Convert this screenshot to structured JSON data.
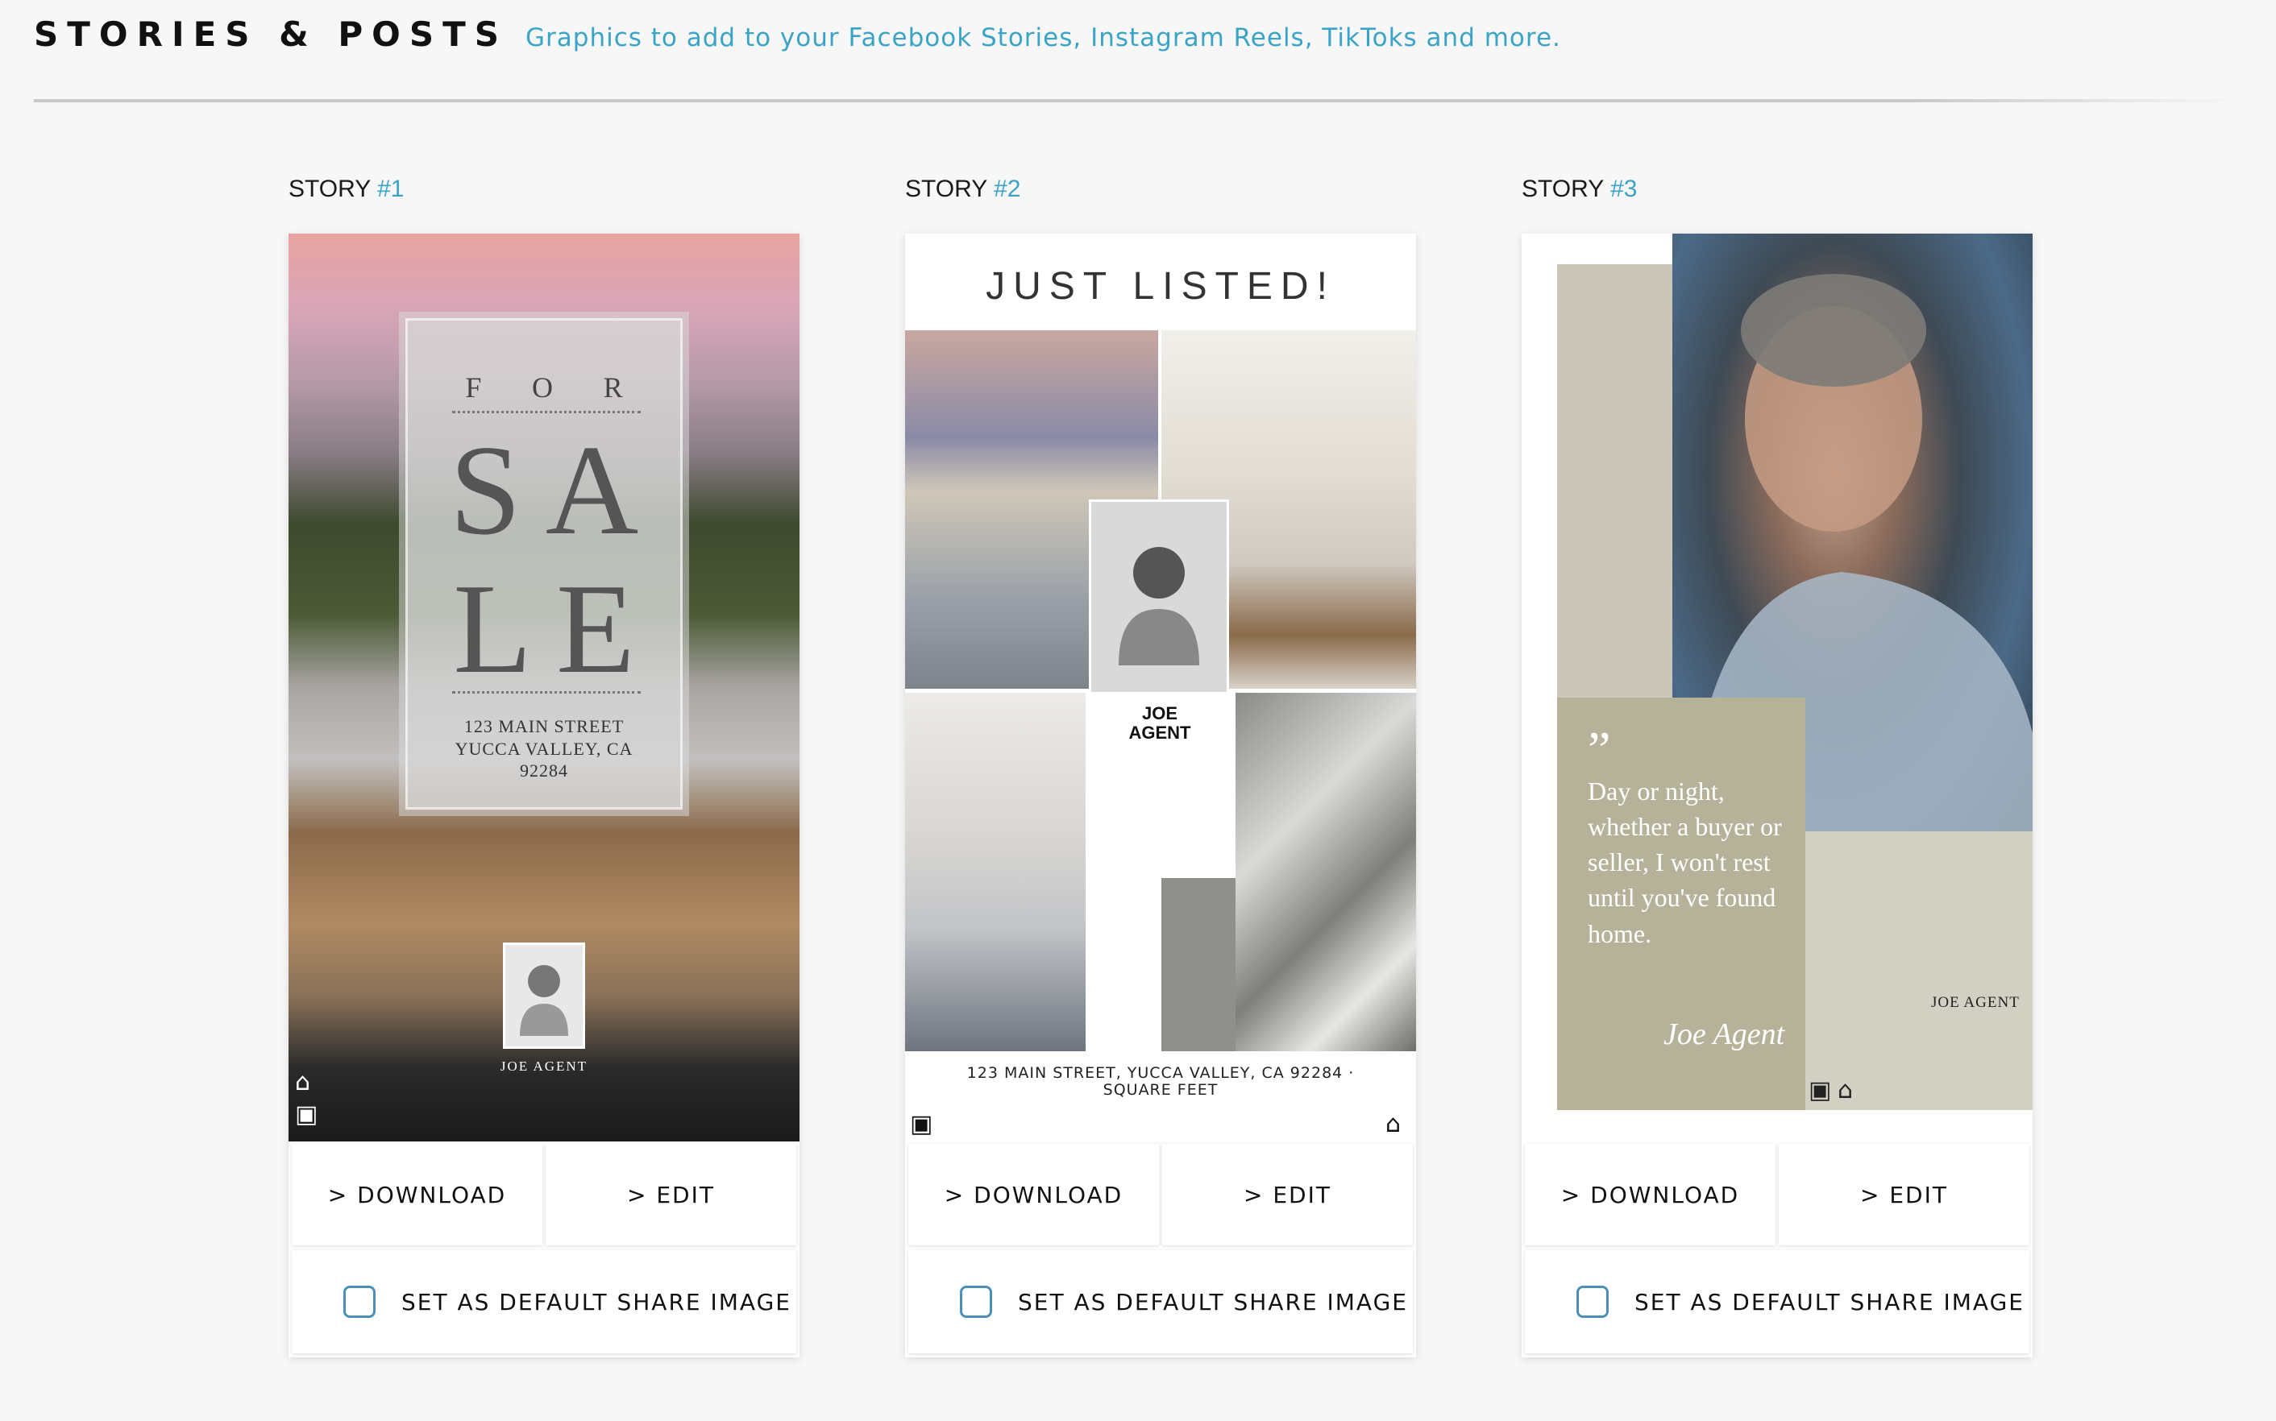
{
  "header": {
    "title": "STORIES & POSTS",
    "subtitle": "Graphics to add to your Facebook Stories, Instagram Reels, TikToks and more."
  },
  "colors": {
    "accent": "#3aa3c8",
    "checkbox_border": "#4a90b8"
  },
  "stories": [
    {
      "label_prefix": "STORY",
      "label_num": "#1",
      "download_label": "> DOWNLOAD",
      "edit_label": "> EDIT",
      "default_label": "SET AS DEFAULT SHARE IMAGE",
      "graphic": {
        "for_letters": [
          "F",
          "O",
          "R"
        ],
        "big_line1": "SA",
        "big_line2": "LE",
        "address": [
          "123 MAIN STREET",
          "YUCCA VALLEY, CA",
          "92284"
        ],
        "agent": "JOE AGENT"
      }
    },
    {
      "label_prefix": "STORY",
      "label_num": "#2",
      "download_label": "> DOWNLOAD",
      "edit_label": "> EDIT",
      "default_label": "SET AS DEFAULT SHARE IMAGE",
      "graphic": {
        "headline": "JUST LISTED!",
        "agent_line1": "JOE",
        "agent_line2": "AGENT",
        "address_line1": "123 MAIN STREET, YUCCA VALLEY, CA 92284 ·",
        "address_line2": "SQUARE FEET"
      }
    },
    {
      "label_prefix": "STORY",
      "label_num": "#3",
      "download_label": "> DOWNLOAD",
      "edit_label": "> EDIT",
      "default_label": "SET AS DEFAULT SHARE IMAGE",
      "graphic": {
        "quote_mark": "”",
        "quote": "Day or night, whether a buyer or seller, I won't rest until you've found home.",
        "signature": "Joe Agent",
        "agent": "JOE AGENT"
      }
    }
  ]
}
